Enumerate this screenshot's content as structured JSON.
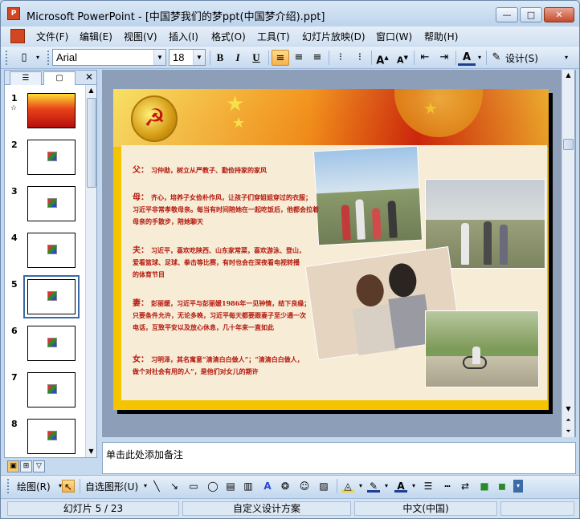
{
  "window": {
    "title": "Microsoft PowerPoint - [中国梦我们的梦ppt(中国梦介绍).ppt]",
    "app_icon_label": "P",
    "minimize": "—",
    "maximize": "□",
    "close": "✕"
  },
  "menu": {
    "items": [
      "文件(F)",
      "编辑(E)",
      "视图(V)",
      "插入(I)",
      "格式(O)",
      "工具(T)",
      "幻灯片放映(D)",
      "窗口(W)",
      "帮助(H)"
    ]
  },
  "toolbar": {
    "font_name": "Arial",
    "font_size": "18",
    "bold": "B",
    "italic": "I",
    "underline": "U",
    "design_label": "设计(S)"
  },
  "slides_pane": {
    "tab_outline": "☰",
    "tab_slides": "▢",
    "close": "✕",
    "items": [
      {
        "num": "1"
      },
      {
        "num": "2"
      },
      {
        "num": "3"
      },
      {
        "num": "4"
      },
      {
        "num": "5"
      },
      {
        "num": "6"
      },
      {
        "num": "7"
      },
      {
        "num": "8"
      }
    ],
    "selected_index": 5
  },
  "slide": {
    "paragraphs": [
      {
        "label": "父：",
        "lines": [
          "习仲勋，树立从严教子、勤俭持家的家风"
        ]
      },
      {
        "label": "母：",
        "lines": [
          "齐心，培养子女俭朴作风，让孩子们穿姐姐穿过的衣服；",
          "习近平非常孝敬母亲。每当有时间陪她在一起吃饭后，他都会拉着",
          "母亲的手散步，陪她聊天"
        ]
      },
      {
        "label": "夫：",
        "lines": [
          "习近平，喜欢吃陕西、山东家常菜，喜欢游泳、登山，",
          "爱看篮球、足球、拳击等比赛，有时也会在深夜看电视转播",
          "的体育节目"
        ]
      },
      {
        "label": "妻：",
        "lines": [
          "彭丽媛，习近平与彭丽媛1986年一见钟情，结下良缘；",
          "只要条件允许，无论多晚，习近平每天都要跟妻子至少通一次",
          "电话，互致平安以及放心休息，几十年来一直如此"
        ]
      },
      {
        "label": "女：",
        "lines": [
          "习明泽，其名寓意“清清白白做人”；“清清白白做人，",
          "做个对社会有用的人”，是他们对女儿的期许"
        ]
      }
    ]
  },
  "notes": {
    "placeholder": "单击此处添加备注"
  },
  "drawing_toolbar": {
    "draw_label": "绘图(R)",
    "autoshapes_label": "自选图形(U)"
  },
  "status": {
    "slide_info": "幻灯片 5 / 23",
    "design": "自定义设计方案",
    "language": "中文(中国)"
  },
  "colors": {
    "slide_text": "#b3170d",
    "slide_frame": "#f4c400",
    "chrome": "#c5d9ef"
  }
}
